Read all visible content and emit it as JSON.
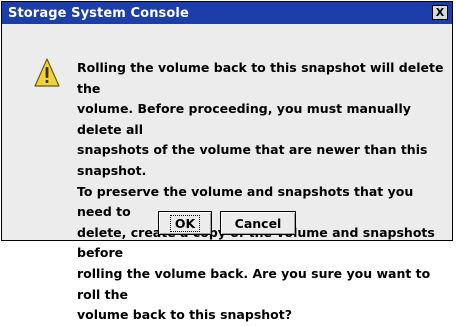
{
  "window": {
    "title": "Storage System Console",
    "close_glyph": "X"
  },
  "dialog": {
    "icon": "warning-triangle-icon",
    "message": "Rolling the volume back to this snapshot will delete the\nvolume. Before proceeding, you must manually delete all\nsnapshots of the volume that are newer than this snapshot.\nTo preserve the volume and snapshots that you need to\ndelete, create a copy of the volume and snapshots before\nrolling the volume back. Are you sure you want to roll the\nvolume back to this snapshot?",
    "ok_label": "OK",
    "cancel_label": "Cancel"
  },
  "colors": {
    "titlebar": "#1c3ea8",
    "dialog_bg": "#ececec",
    "warning_fill": "#f2d23b"
  }
}
